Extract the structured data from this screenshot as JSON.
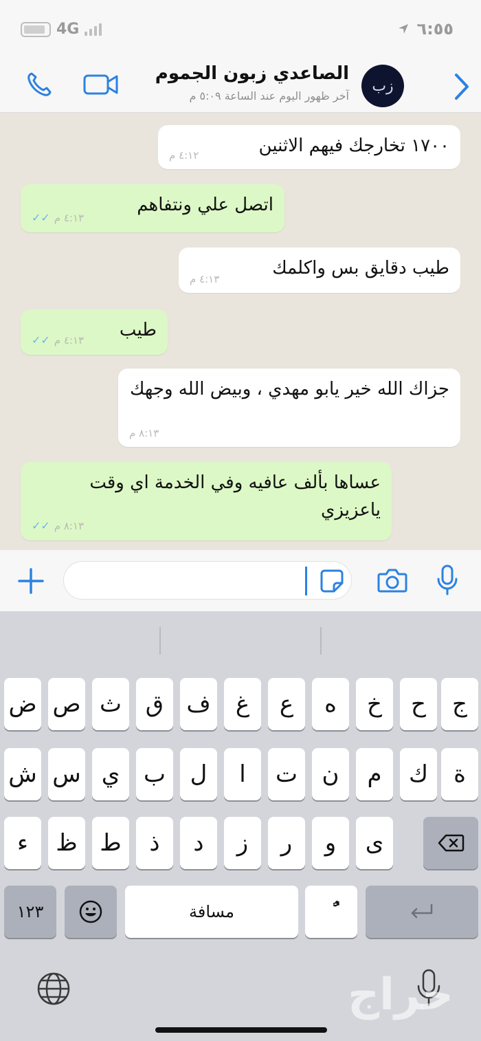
{
  "status_bar": {
    "network": "4G",
    "time": "٦:٥٥"
  },
  "chat_header": {
    "contact_name": "الصاعدي زبون الجموم",
    "last_seen": "آخر ظهور اليوم عند الساعة ٥:٠٩ م",
    "avatar_text": "زب"
  },
  "messages": [
    {
      "direction": "in",
      "text": "١٧٠٠ تخارجك فيهم الاثنين",
      "time": "٤:١٢ م"
    },
    {
      "direction": "out",
      "text": "اتصل علي ونتفاهم",
      "time": "٤:١٣ م"
    },
    {
      "direction": "in",
      "text": "طيب دقايق بس واكلمك",
      "time": "٤:١٣ م"
    },
    {
      "direction": "out",
      "text": "طيب",
      "time": "٤:١٣ م"
    },
    {
      "direction": "in",
      "text": "جزاك الله خير يابو مهدي ، وبيض الله وجهك",
      "time": "٨:١٣ م"
    },
    {
      "direction": "out",
      "text": "عساها بألف عافيه وفي الخدمة اي وقت ياعزيزي",
      "time": "٨:١٣ م"
    }
  ],
  "input": {
    "placeholder": ""
  },
  "keyboard": {
    "row1": [
      "ض",
      "ص",
      "ث",
      "ق",
      "ف",
      "غ",
      "ع",
      "ه",
      "خ",
      "ح",
      "ج"
    ],
    "row2": [
      "ش",
      "س",
      "ي",
      "ب",
      "ل",
      "ا",
      "ت",
      "ن",
      "م",
      "ك",
      "ة"
    ],
    "row3": [
      "ء",
      "ظ",
      "ط",
      "ذ",
      "د",
      "ز",
      "ر",
      "و",
      "ى"
    ],
    "numbers_key": "١٢٣",
    "space_key": "مسافة",
    "diacritic_key": "ًٌ"
  },
  "watermark": "حراج",
  "colors": {
    "incoming_bubble": "#ffffff",
    "outgoing_bubble": "#dcf8c6",
    "accent": "#2b82e0",
    "chat_background": "#e9e4dc"
  }
}
